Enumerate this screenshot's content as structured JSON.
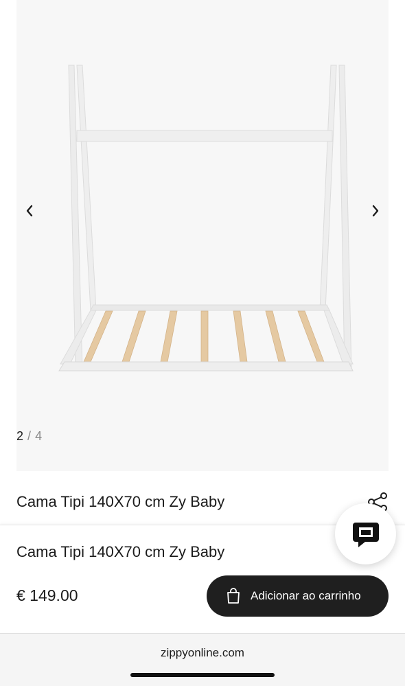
{
  "gallery": {
    "image_alt": "Cama Tipi 140X70 cm Zy Baby",
    "current": "2",
    "separator": "/",
    "total": "4",
    "prev_icon": "chevron-left-icon",
    "next_icon": "chevron-right-icon"
  },
  "product": {
    "title": "Cama Tipi 140X70 cm Zy Baby",
    "share_icon": "share-icon"
  },
  "sticky_bar": {
    "title": "Cama Tipi 140X70 cm Zy Baby",
    "price": "€ 149.00",
    "cart_button_label": "Adicionar ao carrinho",
    "cart_icon": "shopping-bag-icon"
  },
  "chat": {
    "icon": "chat-bubble-icon"
  },
  "browser": {
    "url": "zippyonline.com"
  },
  "colors": {
    "accent": "#1f1f1f",
    "gallery_bg": "#f7f7f7",
    "muted": "#8a8a8a"
  }
}
